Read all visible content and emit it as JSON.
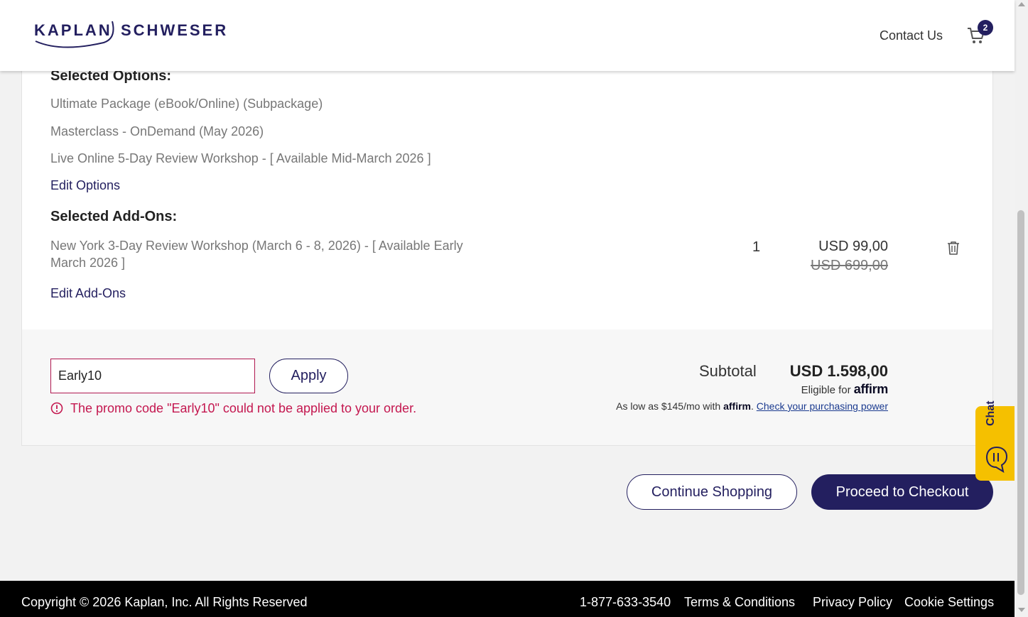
{
  "header": {
    "logo_left": "KAPLAN",
    "logo_right": "SCHWESER",
    "contact_label": "Contact Us",
    "cart_count": "2"
  },
  "options": {
    "heading": "Selected Options:",
    "items": [
      "Ultimate Package (eBook/Online) (Subpackage)",
      "Masterclass - OnDemand (May 2026)",
      "Live Online 5-Day Review Workshop - [ Available Mid-March 2026 ]"
    ],
    "edit_label": "Edit Options"
  },
  "addons": {
    "heading": "Selected Add-Ons:",
    "item": {
      "name": "New York 3-Day Review Workshop (March 6 - 8, 2026) - [ Available Early March 2026 ]",
      "quantity": "1",
      "price": "USD 99,00",
      "original_price": "USD 699,00"
    },
    "edit_label": "Edit Add-Ons"
  },
  "promo": {
    "value": "Early10",
    "apply_label": "Apply",
    "error": "The promo code \"Early10\" could not be applied to your order."
  },
  "summary": {
    "subtotal_label": "Subtotal",
    "subtotal_value": "USD 1.598,00",
    "eligible_label": "Eligible for",
    "affirm_brand": "affirm",
    "aslow_text": "As low as $145/mo with",
    "aslow_link": "Check your purchasing power"
  },
  "actions": {
    "continue_label": "Continue Shopping",
    "checkout_label": "Proceed to Checkout"
  },
  "chat": {
    "label": "Chat"
  },
  "footer": {
    "copyright": "Copyright © 2026 Kaplan, Inc. All Rights Reserved",
    "phone": "1-877-633-3540",
    "terms": "Terms & Conditions",
    "privacy": "Privacy Policy",
    "cookies": "Cookie Settings"
  },
  "colors": {
    "brand": "#231f5f",
    "error": "#c4174f",
    "chat_bg": "#f5c000"
  }
}
